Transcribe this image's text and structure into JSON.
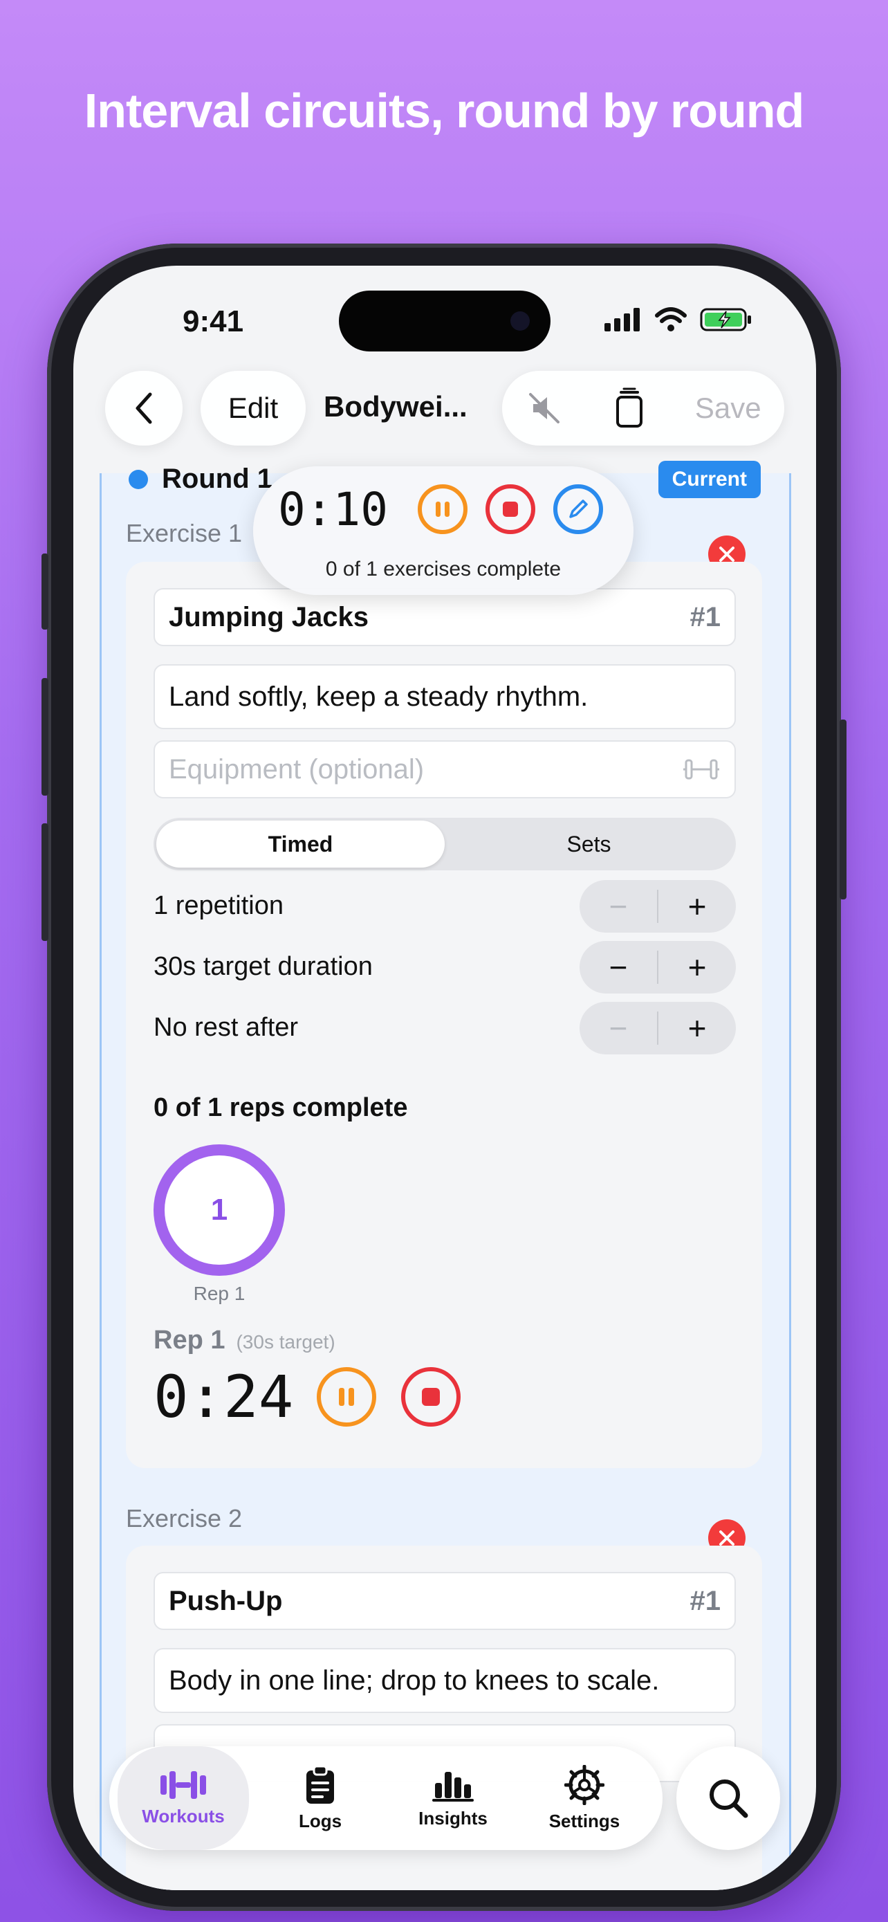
{
  "headline": "Interval circuits, round by round",
  "status": {
    "time": "9:41"
  },
  "nav": {
    "edit_label": "Edit",
    "title": "Bodywei...",
    "save_label": "Save"
  },
  "round": {
    "label": "Round 1",
    "badge": "Current"
  },
  "floating_timer": {
    "time": "0:10",
    "subtitle": "0 of 1 exercises complete"
  },
  "exercises": [
    {
      "label": "Exercise 1",
      "name": "Jumping Jacks",
      "index": "#1",
      "note": "Land softly, keep a steady rhythm.",
      "equipment_placeholder": "Equipment (optional)",
      "mode_options": [
        "Timed",
        "Sets"
      ],
      "mode_selected": "Timed",
      "rows": [
        {
          "label": "1 repetition",
          "minus": "−",
          "plus": "+"
        },
        {
          "label": "30s target duration",
          "minus": "−",
          "plus": "+"
        },
        {
          "label": "No rest after",
          "minus": "−",
          "plus": "+"
        }
      ],
      "reps_complete": "0 of 1 reps complete",
      "rep_number": "1",
      "rep_caption": "Rep 1",
      "rep_heading": "Rep 1",
      "rep_target": "(30s target)",
      "rep_timer": "0:24"
    },
    {
      "label": "Exercise 2",
      "name": "Push-Up",
      "index": "#1",
      "note": "Body in one line; drop to knees to scale."
    }
  ],
  "tabs": [
    {
      "label": "Workouts",
      "icon": "dumbbell-icon",
      "active": true
    },
    {
      "label": "Logs",
      "icon": "clipboard-icon",
      "active": false
    },
    {
      "label": "Insights",
      "icon": "bar-chart-icon",
      "active": false
    },
    {
      "label": "Settings",
      "icon": "gear-icon",
      "active": false
    }
  ],
  "colors": {
    "accent_purple": "#8a4fe6",
    "blue": "#2a8bee",
    "orange": "#f7931e",
    "red": "#e9323b"
  }
}
